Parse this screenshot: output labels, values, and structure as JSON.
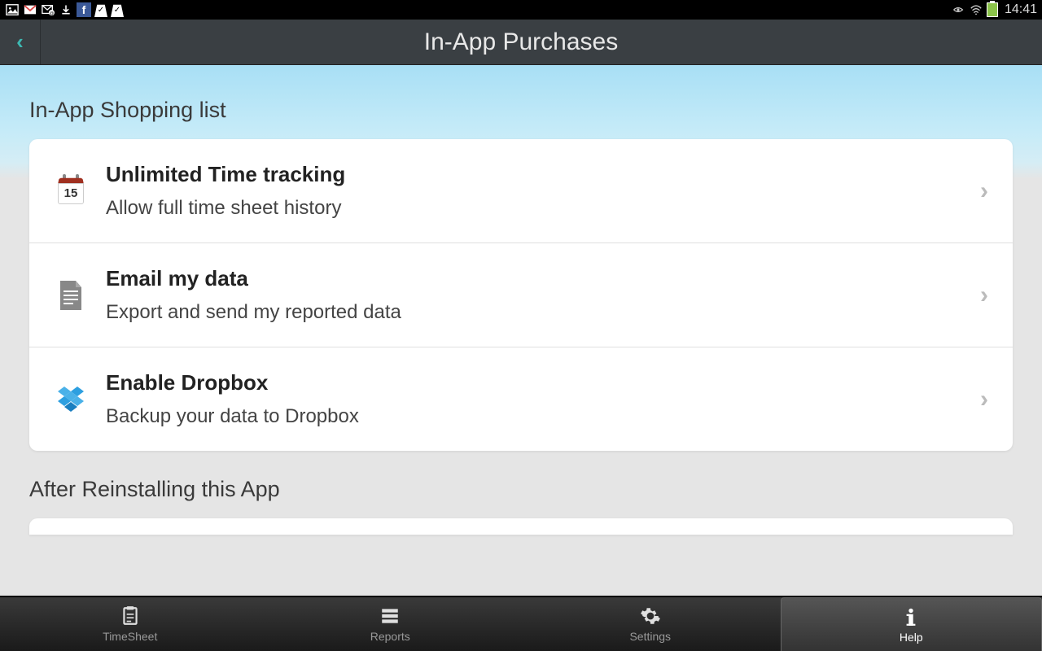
{
  "status_bar": {
    "time": "14:41"
  },
  "header": {
    "title": "In-App Purchases"
  },
  "sections": {
    "shopping_list": {
      "header": "In-App Shopping list",
      "items": [
        {
          "icon": "calendar",
          "calendar_day": "15",
          "title": "Unlimited Time tracking",
          "subtitle": "Allow full time sheet history"
        },
        {
          "icon": "document",
          "title": "Email my data",
          "subtitle": "Export and send my reported data"
        },
        {
          "icon": "dropbox",
          "title": "Enable Dropbox",
          "subtitle": "Backup your data to Dropbox"
        }
      ]
    },
    "reinstall": {
      "header": "After Reinstalling this App"
    }
  },
  "bottom_nav": {
    "items": [
      {
        "label": "TimeSheet",
        "icon": "timesheet",
        "active": false
      },
      {
        "label": "Reports",
        "icon": "reports",
        "active": false
      },
      {
        "label": "Settings",
        "icon": "settings",
        "active": false
      },
      {
        "label": "Help",
        "icon": "info",
        "active": true
      }
    ]
  }
}
